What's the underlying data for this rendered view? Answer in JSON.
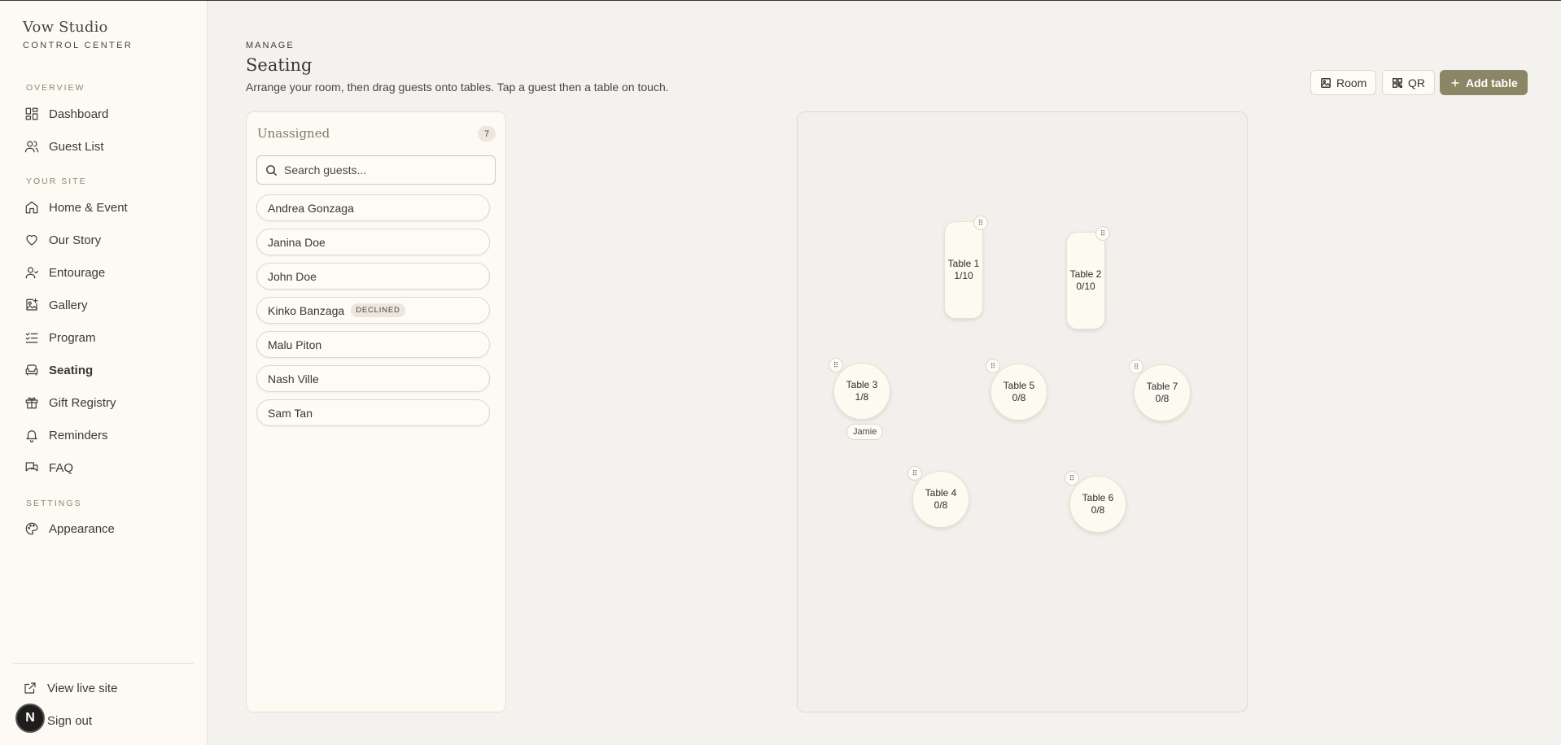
{
  "brand": {
    "name": "Vow Studio",
    "subtitle": "CONTROL CENTER"
  },
  "sidebar": {
    "sections": {
      "overview": "OVERVIEW",
      "your_site": "YOUR SITE",
      "settings": "SETTINGS"
    },
    "items": [
      {
        "label": "Dashboard",
        "icon": "dashboard-icon"
      },
      {
        "label": "Guest List",
        "icon": "users-icon"
      },
      {
        "label": "Home & Event",
        "icon": "home-icon"
      },
      {
        "label": "Our Story",
        "icon": "heart-icon"
      },
      {
        "label": "Entourage",
        "icon": "user-icon"
      },
      {
        "label": "Gallery",
        "icon": "image-plus-icon"
      },
      {
        "label": "Program",
        "icon": "list-check-icon"
      },
      {
        "label": "Seating",
        "icon": "sofa-icon",
        "active": true
      },
      {
        "label": "Gift Registry",
        "icon": "gift-icon"
      },
      {
        "label": "Reminders",
        "icon": "bell-icon"
      },
      {
        "label": "FAQ",
        "icon": "chat-icon"
      },
      {
        "label": "Appearance",
        "icon": "palette-icon"
      }
    ],
    "view_live": "View live site",
    "sign_out": "Sign out",
    "avatar_initial": "N"
  },
  "header": {
    "eyebrow": "MANAGE",
    "title": "Seating",
    "subtitle": "Arrange your room, then drag guests onto tables. Tap a guest then a table on touch.",
    "buttons": {
      "room": "Room",
      "qr": "QR",
      "add_table": "Add table"
    }
  },
  "unassigned": {
    "title": "Unassigned",
    "count": "7",
    "search_placeholder": "Search guests...",
    "guests": [
      {
        "name": "Andrea Gonzaga"
      },
      {
        "name": "Janina Doe"
      },
      {
        "name": "John Doe"
      },
      {
        "name": "Kinko Banzaga",
        "tag": "DECLINED"
      },
      {
        "name": "Malu Piton"
      },
      {
        "name": "Nash Ville"
      },
      {
        "name": "Sam Tan"
      }
    ]
  },
  "tables": [
    {
      "name": "Table 1",
      "seats": "1/10",
      "shape": "rect"
    },
    {
      "name": "Table 2",
      "seats": "0/10",
      "shape": "rect"
    },
    {
      "name": "Table 3",
      "seats": "1/8",
      "shape": "round",
      "guest_chip": "Jamie"
    },
    {
      "name": "Table 5",
      "seats": "0/8",
      "shape": "round"
    },
    {
      "name": "Table 7",
      "seats": "0/8",
      "shape": "round"
    },
    {
      "name": "Table 4",
      "seats": "0/8",
      "shape": "round"
    },
    {
      "name": "Table 6",
      "seats": "0/8",
      "shape": "round"
    }
  ],
  "colors": {
    "accent": "#8b8766",
    "sidebar_bg": "#fdfaf3",
    "page_bg": "#f3f2ee"
  }
}
